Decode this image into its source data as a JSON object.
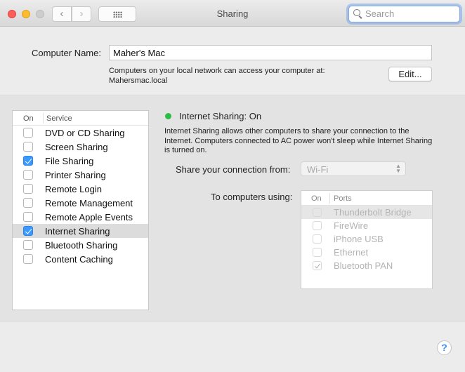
{
  "window": {
    "title": "Sharing",
    "search_placeholder": "Search",
    "back_glyph": "‹",
    "forward_glyph": "›"
  },
  "computer_name": {
    "label": "Computer Name:",
    "value": "Maher's Mac",
    "description_line1": "Computers on your local network can access your computer at:",
    "description_line2": "Mahersmac.local",
    "edit_label": "Edit..."
  },
  "services": {
    "header_on": "On",
    "header_service": "Service",
    "items": [
      {
        "label": "DVD or CD Sharing",
        "checked": false,
        "selected": false
      },
      {
        "label": "Screen Sharing",
        "checked": false,
        "selected": false
      },
      {
        "label": "File Sharing",
        "checked": true,
        "selected": false
      },
      {
        "label": "Printer Sharing",
        "checked": false,
        "selected": false
      },
      {
        "label": "Remote Login",
        "checked": false,
        "selected": false
      },
      {
        "label": "Remote Management",
        "checked": false,
        "selected": false
      },
      {
        "label": "Remote Apple Events",
        "checked": false,
        "selected": false
      },
      {
        "label": "Internet Sharing",
        "checked": true,
        "selected": true
      },
      {
        "label": "Bluetooth Sharing",
        "checked": false,
        "selected": false
      },
      {
        "label": "Content Caching",
        "checked": false,
        "selected": false
      }
    ]
  },
  "detail": {
    "status_text": "Internet Sharing: On",
    "status_color": "#2bbd46",
    "description": "Internet Sharing allows other computers to share your connection to the Internet. Computers connected to AC power won't sleep while Internet Sharing is turned on.",
    "share_from_label": "Share your connection from:",
    "share_from_value": "Wi-Fi",
    "to_computers_label": "To computers using:",
    "ports_header_on": "On",
    "ports_header_ports": "Ports",
    "ports": [
      {
        "label": "Thunderbolt Bridge",
        "checked": false,
        "selected": true
      },
      {
        "label": "FireWire",
        "checked": false,
        "selected": false
      },
      {
        "label": "iPhone USB",
        "checked": false,
        "selected": false
      },
      {
        "label": "Ethernet",
        "checked": false,
        "selected": false
      },
      {
        "label": "Bluetooth PAN",
        "checked": true,
        "selected": false
      }
    ]
  },
  "help_label": "?"
}
